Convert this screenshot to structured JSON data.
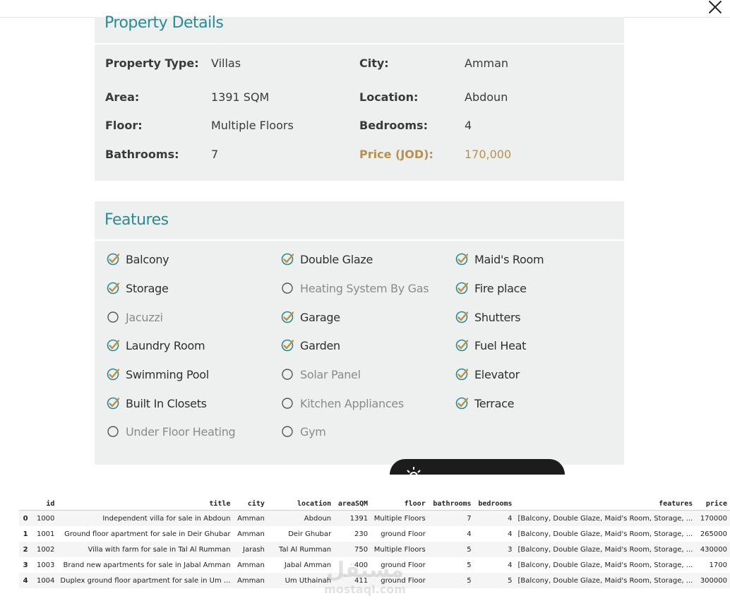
{
  "details": {
    "title": "Property Details",
    "rows": [
      {
        "l1": "Property Type:",
        "v1": "Villas",
        "l2": "City:",
        "v2": "Amman"
      },
      {
        "l1": "Area:",
        "v1": "1391 SQM",
        "l2": "Location:",
        "v2": "Abdoun"
      },
      {
        "l1": "Floor:",
        "v1": "Multiple Floors",
        "l2": "Bedrooms:",
        "v2": "4"
      },
      {
        "l1": "Bathrooms:",
        "v1": "7",
        "l2": "Price (JOD):",
        "v2": "170,000"
      }
    ]
  },
  "features": {
    "title": "Features",
    "col1": [
      {
        "label": "Balcony",
        "checked": true
      },
      {
        "label": "Storage",
        "checked": true
      },
      {
        "label": "Jacuzzi",
        "checked": false
      },
      {
        "label": "Laundry Room",
        "checked": true
      },
      {
        "label": "Swimming Pool",
        "checked": true
      },
      {
        "label": "Built In Closets",
        "checked": true
      },
      {
        "label": "Under Floor Heating",
        "checked": false
      }
    ],
    "col2": [
      {
        "label": "Double Glaze",
        "checked": true
      },
      {
        "label": "Heating System By Gas",
        "checked": false
      },
      {
        "label": "Garage",
        "checked": true
      },
      {
        "label": "Garden",
        "checked": true
      },
      {
        "label": "Solar Panel",
        "checked": false
      },
      {
        "label": "Kitchen Appliances",
        "checked": false
      },
      {
        "label": "Gym",
        "checked": false
      }
    ],
    "col3": [
      {
        "label": "Maid's Room",
        "checked": true
      },
      {
        "label": "Fire place",
        "checked": true
      },
      {
        "label": "Shutters",
        "checked": true
      },
      {
        "label": "Fuel Heat",
        "checked": true
      },
      {
        "label": "Elevator",
        "checked": true
      },
      {
        "label": "Terrace",
        "checked": true
      }
    ]
  },
  "table": {
    "columns": [
      "",
      "id",
      "title",
      "city",
      "location",
      "areaSQM",
      "floor",
      "bathrooms",
      "bedrooms",
      "features",
      "price"
    ],
    "rows": [
      [
        "0",
        "1000",
        "Independent villa for sale in Abdoun",
        "Amman",
        "Abdoun",
        "1391",
        "Multiple Floors",
        "7",
        "4",
        "[Balcony, Double Glaze, Maid's Room, Storage, ...",
        "170000"
      ],
      [
        "1",
        "1001",
        "Ground floor apartment for sale in Deir Ghubar",
        "Amman",
        "Deir Ghubar",
        "230",
        "ground Floor",
        "4",
        "4",
        "[Balcony, Double Glaze, Maid's Room, Storage, ...",
        "265000"
      ],
      [
        "2",
        "1002",
        "Villa with farm for sale in Tal Al Rumman",
        "Jarash",
        "Tal Al Rumman",
        "750",
        "Multiple Floors",
        "5",
        "3",
        "[Balcony, Double Glaze, Maid's Room, Storage, ...",
        "430000"
      ],
      [
        "3",
        "1003",
        "Brand new apartments for sale in Jabal Amman",
        "Amman",
        "Jabal Amman",
        "400",
        "ground Floor",
        "5",
        "4",
        "[Balcony, Double Glaze, Maid's Room, Storage, ...",
        "1700"
      ],
      [
        "4",
        "1004",
        "Duplex ground floor apartment for sale in Um ...",
        "Amman",
        "Um Uthainah",
        "411",
        "ground Floor",
        "5",
        "5",
        "[Balcony, Double Glaze, Maid's Room, Storage, ...",
        "300000"
      ]
    ]
  },
  "watermark": {
    "arabic": "مستقل",
    "latin": "mostaql.com"
  },
  "colors": {
    "accent": "#2b8a93",
    "gold": "#b8924a",
    "panel": "#eef0ef"
  }
}
